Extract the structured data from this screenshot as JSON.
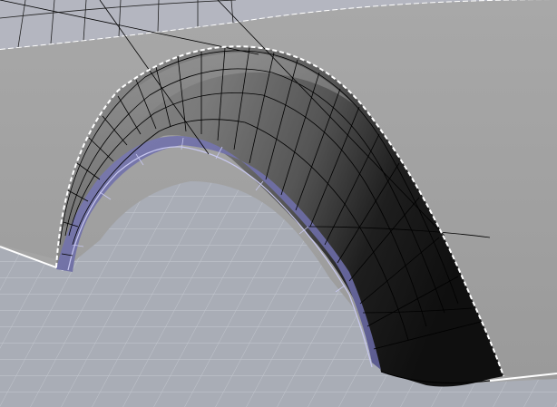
{
  "viewport": {
    "kind": "3d-modeling-perspective-viewport",
    "colors": {
      "background_sky": "#aaaeb8",
      "ground_grid": "#a9adb6",
      "grid_line": "#c3c7cf",
      "panel_upper": "#a6a6a6",
      "panel_lower": "#9c9c9c",
      "body_surface_light": "#7a7a7a",
      "body_surface_dark": "#101010",
      "selected_surface": "#6f6fa2",
      "selected_edge": "#c8c8f0",
      "silhouette_dash": "#ffffff",
      "isoparm": "#000000"
    },
    "objects": [
      {
        "name": "wheel-arch-surface",
        "state": "unselected"
      },
      {
        "name": "wheel-arch-inner-lip",
        "state": "selected"
      },
      {
        "name": "body-side-panel",
        "state": "unselected"
      },
      {
        "name": "ground-grid",
        "state": "reference"
      }
    ]
  }
}
